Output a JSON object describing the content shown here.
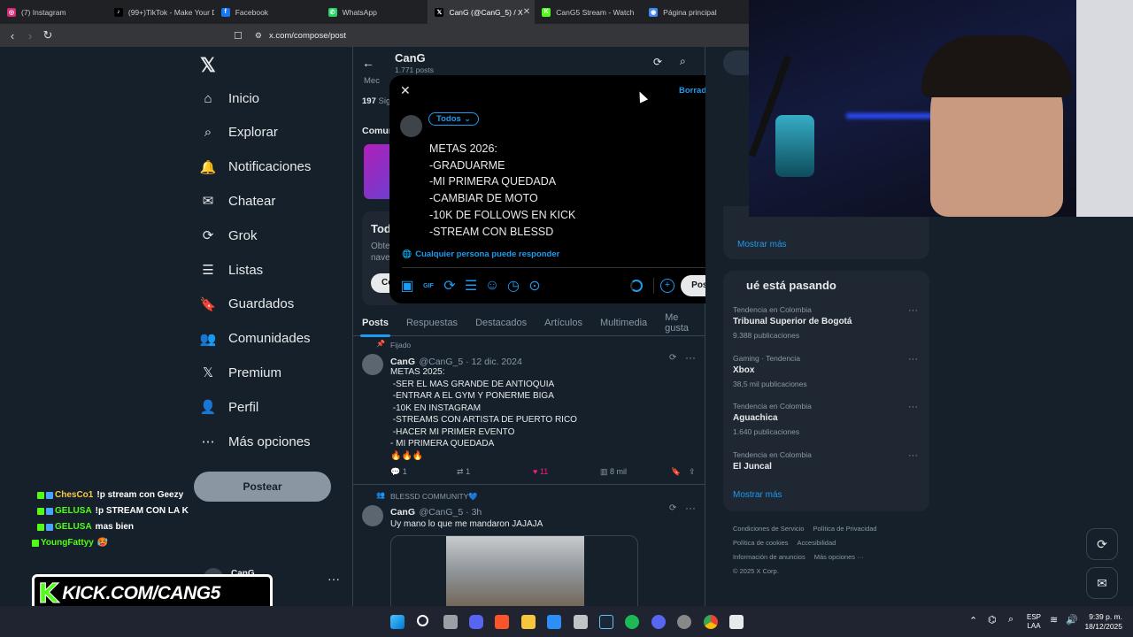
{
  "browser": {
    "tabs": [
      {
        "title": "(7) Instagram",
        "color": "#d62976",
        "glyph": "◎"
      },
      {
        "title": "(99+)TikTok - Make Your D",
        "color": "#000000",
        "glyph": "♪"
      },
      {
        "title": "Facebook",
        "color": "#1877f2",
        "glyph": "f"
      },
      {
        "title": "WhatsApp",
        "color": "#25d366",
        "glyph": "✆"
      },
      {
        "title": "CanG (@CanG_5) / X",
        "color": "#000000",
        "glyph": "𝕏",
        "active": true
      },
      {
        "title": "CanG5 Stream - Watch",
        "color": "#53fc18",
        "glyph": "K"
      },
      {
        "title": "Página principal",
        "color": "#4285f4",
        "glyph": "◉"
      }
    ],
    "url": "x.com/compose/post"
  },
  "sidebar": {
    "items": [
      {
        "label": "Inicio",
        "icon": "home-icon"
      },
      {
        "label": "Explorar",
        "icon": "search-icon"
      },
      {
        "label": "Notificaciones",
        "icon": "bell-icon"
      },
      {
        "label": "Chatear",
        "icon": "mail-icon"
      },
      {
        "label": "Grok",
        "icon": "grok-icon"
      },
      {
        "label": "Listas",
        "icon": "list-icon"
      },
      {
        "label": "Guardados",
        "icon": "bookmark-icon"
      },
      {
        "label": "Comunidades",
        "icon": "people-icon"
      },
      {
        "label": "Premium",
        "icon": "x-logo-icon"
      },
      {
        "label": "Perfil",
        "icon": "person-icon"
      },
      {
        "label": "Más opciones",
        "icon": "more-circle-icon"
      }
    ],
    "post_label": "Postear",
    "account_name": "CanG"
  },
  "profile": {
    "name": "CanG",
    "posts_count": "1.771 posts",
    "following": "197",
    "following_label": "Sig",
    "media_label": "Mec",
    "communities_label": "Comun",
    "promo_title": "Tod",
    "promo_line1": "Obte",
    "promo_line2": "nave",
    "promo_button": "Co"
  },
  "profile_tabs": [
    "Posts",
    "Respuestas",
    "Destacados",
    "Artículos",
    "Multimedia",
    "Me gusta"
  ],
  "posts": [
    {
      "pinned_label": "Fijado",
      "name": "CanG",
      "handle": "@CanG_5 · 12 dic. 2024",
      "text": "METAS 2025:\n -SER EL MAS GRANDE DE ANTIOQUIA\n -ENTRAR A EL GYM Y PONERME BIGA\n -10K EN INSTAGRAM\n -STREAMS CON ARTISTA DE PUERTO RICO\n -HACER MI PRIMER EVENTO\n- MI PRIMERA QUEDADA\n🔥🔥🔥",
      "replies": "1",
      "reposts": "1",
      "likes": "11",
      "views": "8 mil"
    },
    {
      "community_label": "BLESSD COMMUNITY💙",
      "name": "CanG",
      "handle": "@CanG_5 · 3h",
      "text": "Uy mano lo que me mandaron JAJAJA"
    }
  ],
  "compose": {
    "drafts_label": "Borradores",
    "audience_label": "Todos",
    "text": "METAS 2026:\n-GRADUARME\n-MI PRIMERA QUEDADA\n-CAMBIAR DE MOTO\n-10K DE FOLLOWS EN KICK\n-STREAM CON BLESSD",
    "reply_setting": "Cualquier persona puede responder",
    "post_button": "Postear"
  },
  "right": {
    "show_more_top": "Mostrar más",
    "happening_title": "ué está pasando",
    "trends": [
      {
        "context": "Tendencia en Colombia",
        "name": "Tribunal Superior de Bogotá",
        "count": "9.388 publicaciones"
      },
      {
        "context": "Gaming · Tendencia",
        "name": "Xbox",
        "count": "38,5 mil publicaciones"
      },
      {
        "context": "Tendencia en Colombia",
        "name": "Aguachica",
        "count": "1.640 publicaciones"
      },
      {
        "context": "Tendencia en Colombia",
        "name": "El Juncal",
        "count": ""
      }
    ],
    "show_more": "Mostrar más",
    "footer": [
      "Condiciones de Servicio",
      "Política de Privacidad",
      "Política de cookies",
      "Accesibilidad",
      "Información de anuncios",
      "Más opciones ···",
      "© 2025 X Corp."
    ]
  },
  "chat": [
    {
      "user": "ChesCo1",
      "color": "#f7c948",
      "msg": "!p stream con Geezy"
    },
    {
      "user": "GELUSA",
      "color": "#53fc18",
      "msg": "!p STREAM CON LA K"
    },
    {
      "user": "GELUSA",
      "color": "#53fc18",
      "msg": "mas bien"
    },
    {
      "user": "YoungFattyy",
      "color": "#53fc18",
      "msg": "🥵"
    }
  ],
  "kick_banner": "KICK.COM/CANG5",
  "taskbar": {
    "lang": "ESP",
    "lang2": "LAA",
    "time": "9:39 p. m.",
    "date": "18/12/2025"
  }
}
